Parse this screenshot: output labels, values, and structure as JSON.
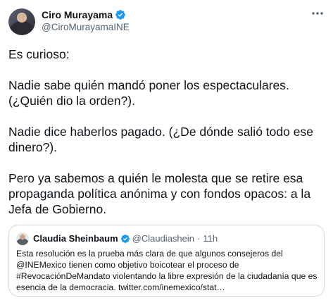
{
  "author": {
    "name": "Ciro Murayama",
    "handle": "@CiroMurayamaINE",
    "verified": true
  },
  "tweet": {
    "lines": [
      "Es curioso:",
      "Nadie sabe quién mandó poner los espectaculares.",
      "(¿Quién dio la orden?).",
      "Nadie dice haberlos pagado. (¿De dónde salió todo ese",
      "dinero?).",
      "Pero ya sabemos a quién le molesta que se retire esa",
      "propaganda política anónima y con fondos opacos: a la",
      "Jefa de Gobierno."
    ]
  },
  "quote": {
    "name": "Claudia Sheinbaum",
    "handle": "@Claudiashein",
    "separator": "·",
    "time": "11h",
    "lines": [
      "Esta resolución es la prueba más clara de que algunos consejeros del",
      "@INEMexico tienen como objetivo boicotear el proceso de",
      "#RevocaciónDeMandato violentando la libre expresión de la ciudadanía que es",
      "esencia de la democracia. twitter.com/inemexico/stat…"
    ]
  },
  "icons": {
    "verified": "verified-badge-icon",
    "more": "more-options-icon"
  },
  "colors": {
    "verified": "#1d9bf0",
    "secondary_text": "#536471",
    "primary_text": "#0f1419",
    "border": "#cfd9de"
  }
}
